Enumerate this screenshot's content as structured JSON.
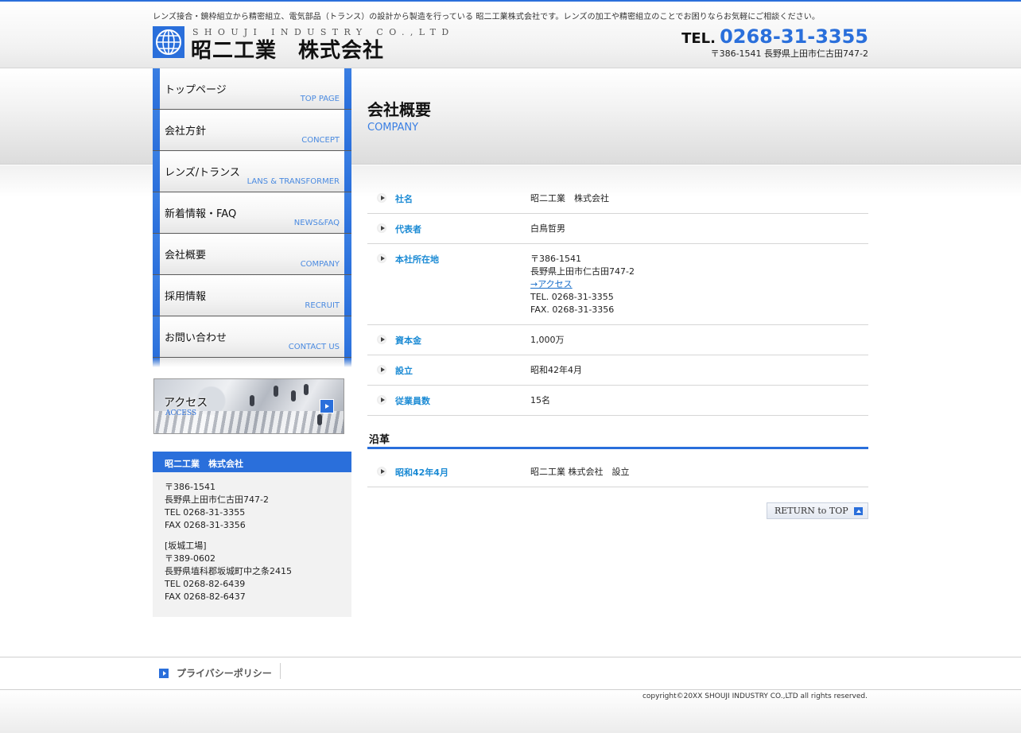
{
  "header": {
    "tagline": "レンズ接合・鏡枠組立から精密組立、電気部品（トランス）の設計から製造を行っている 昭二工業株式会社です。レンズの加工や精密組立のことでお困りならお気軽にご相談ください。",
    "logo_en": "SHOUJI INDUSTRY CO.,LTD",
    "logo_jp": "昭二工業　株式会社",
    "tel_label": "TEL.",
    "tel_number": "0268-31-3355",
    "address": "〒386-1541 長野県上田市仁古田747-2"
  },
  "nav": [
    {
      "jp": "トップページ",
      "en": "TOP PAGE"
    },
    {
      "jp": "会社方針",
      "en": "CONCEPT"
    },
    {
      "jp": "レンズ/トランス",
      "en": "LANS & TRANSFORMER"
    },
    {
      "jp": "新着情報・FAQ",
      "en": "NEWS&FAQ"
    },
    {
      "jp": "会社概要",
      "en": "COMPANY"
    },
    {
      "jp": "採用情報",
      "en": "RECRUIT"
    },
    {
      "jp": "お問い合わせ",
      "en": "CONTACT US"
    }
  ],
  "access_banner": {
    "jp": "アクセス",
    "en": "ACCESS"
  },
  "info": {
    "title": "昭二工業　株式会社",
    "lines1": [
      "〒386-1541",
      "長野県上田市仁古田747-2",
      "TEL 0268-31-3355",
      "FAX 0268-31-3356"
    ],
    "lines2": [
      "[坂城工場]",
      "〒389-0602",
      "長野県埴科郡坂城町中之条2415",
      "TEL 0268-82-6439",
      "FAX 0268-82-6437"
    ]
  },
  "page": {
    "title": "会社概要",
    "subtitle": "COMPANY"
  },
  "company_rows": [
    {
      "label": "社名",
      "lines": [
        "昭二工業　株式会社"
      ]
    },
    {
      "label": "代表者",
      "lines": [
        "白鳥哲男"
      ]
    },
    {
      "label": "本社所在地",
      "lines": [
        "〒386-1541",
        "長野県上田市仁古田747-2"
      ],
      "link": "→アクセス",
      "lines_after": [
        "TEL. 0268-31-3355",
        "FAX. 0268-31-3356"
      ]
    },
    {
      "label": "資本金",
      "lines": [
        "1,000万"
      ]
    },
    {
      "label": "設立",
      "lines": [
        "昭和42年4月"
      ]
    },
    {
      "label": "従業員数",
      "lines": [
        "15名"
      ]
    }
  ],
  "history": {
    "heading": "沿革",
    "rows": [
      {
        "label": "昭和42年4月",
        "lines": [
          "昭二工業 株式会社　設立"
        ]
      }
    ]
  },
  "return_top": "RETURN to TOP",
  "footer": {
    "privacy": "プライバシーポリシー",
    "copyright": "copyright©20XX SHOUJI INDUSTRY CO.,LTD all rights reserved."
  },
  "colors": {
    "accent": "#2a6fdb",
    "label_blue": "#1a8ad4"
  }
}
